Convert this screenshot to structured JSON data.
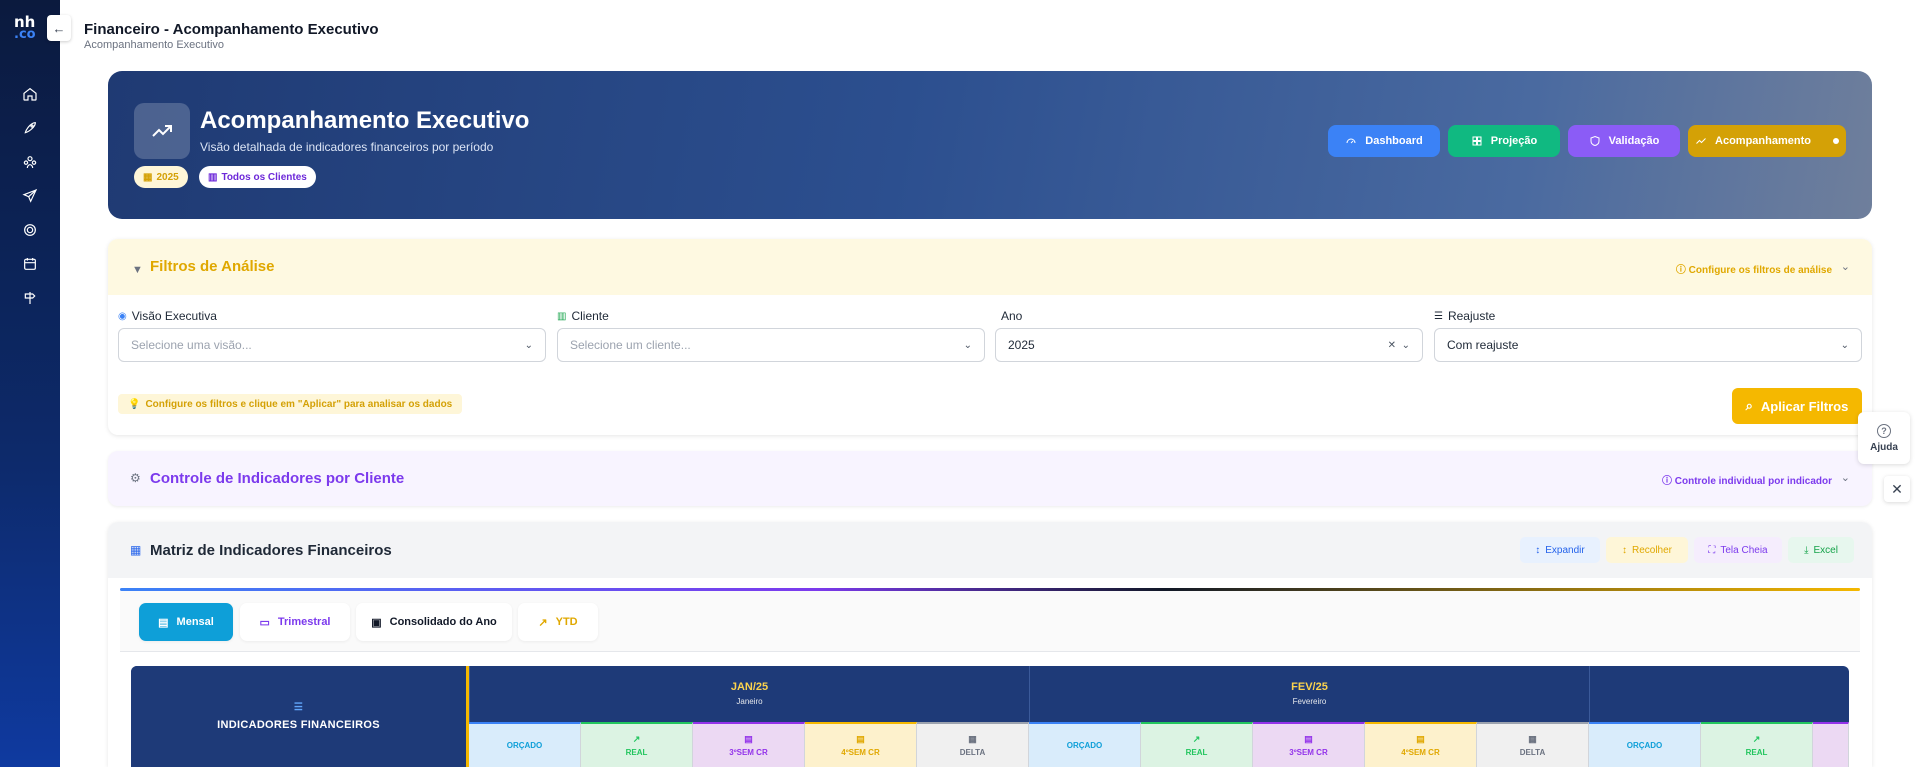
{
  "app": {
    "logo_line1": "nh",
    "logo_line2": ".co",
    "collapse_icon": "←",
    "page_title": "Financeiro - Acompanhamento Executivo",
    "page_subtitle": "Acompanhamento Executivo"
  },
  "hero": {
    "title": "Acompanhamento Executivo",
    "subtitle": "Visão detalhada de indicadores financeiros por período",
    "chip_year": "2025",
    "chip_clients": "Todos os Clientes",
    "buttons": {
      "dashboard": "Dashboard",
      "projecao": "Projeção",
      "validacao": "Validação",
      "acompanhamento": "Acompanhamento"
    },
    "colors": {
      "dashboard": "#3b82f6",
      "projecao": "#10b981",
      "validacao": "#8b5cf6",
      "acompanhamento": "#d4a106"
    }
  },
  "filters": {
    "title": "Filtros de Análise",
    "hint": "Configure os filtros de análise",
    "visao_label": "Visão Executiva",
    "visao_placeholder": "Selecione uma visão...",
    "cliente_label": "Cliente",
    "cliente_placeholder": "Selecione um cliente...",
    "ano_label": "Ano",
    "ano_value": "2025",
    "reajuste_label": "Reajuste",
    "reajuste_value": "Com reajuste",
    "note": "Configure os filtros e clique em \"Aplicar\" para analisar os dados",
    "apply_label": "Aplicar Filtros"
  },
  "controle": {
    "title": "Controle de Indicadores por Cliente",
    "hint": "Controle individual por indicador"
  },
  "help": {
    "label": "Ajuda",
    "close": "✕"
  },
  "matrix": {
    "title": "Matriz de Indicadores Financeiros",
    "actions": {
      "expandir": "Expandir",
      "recolher": "Recolher",
      "tela_cheia": "Tela Cheia",
      "excel": "Excel"
    },
    "tabs": {
      "mensal": "Mensal",
      "trimestral": "Trimestral",
      "consolidado": "Consolidado do Ano",
      "ytd": "YTD"
    },
    "table": {
      "indicator_header": "INDICADORES FINANCEIROS",
      "months": [
        {
          "code": "JAN/25",
          "name": "Janeiro"
        },
        {
          "code": "FEV/25",
          "name": "Fevereiro"
        }
      ],
      "sub_columns": {
        "orcado": "ORÇADO",
        "real": "REAL",
        "sem3": "3ºSEM CR",
        "sem4": "4ºSEM CR",
        "delta": "DELTA"
      }
    }
  }
}
